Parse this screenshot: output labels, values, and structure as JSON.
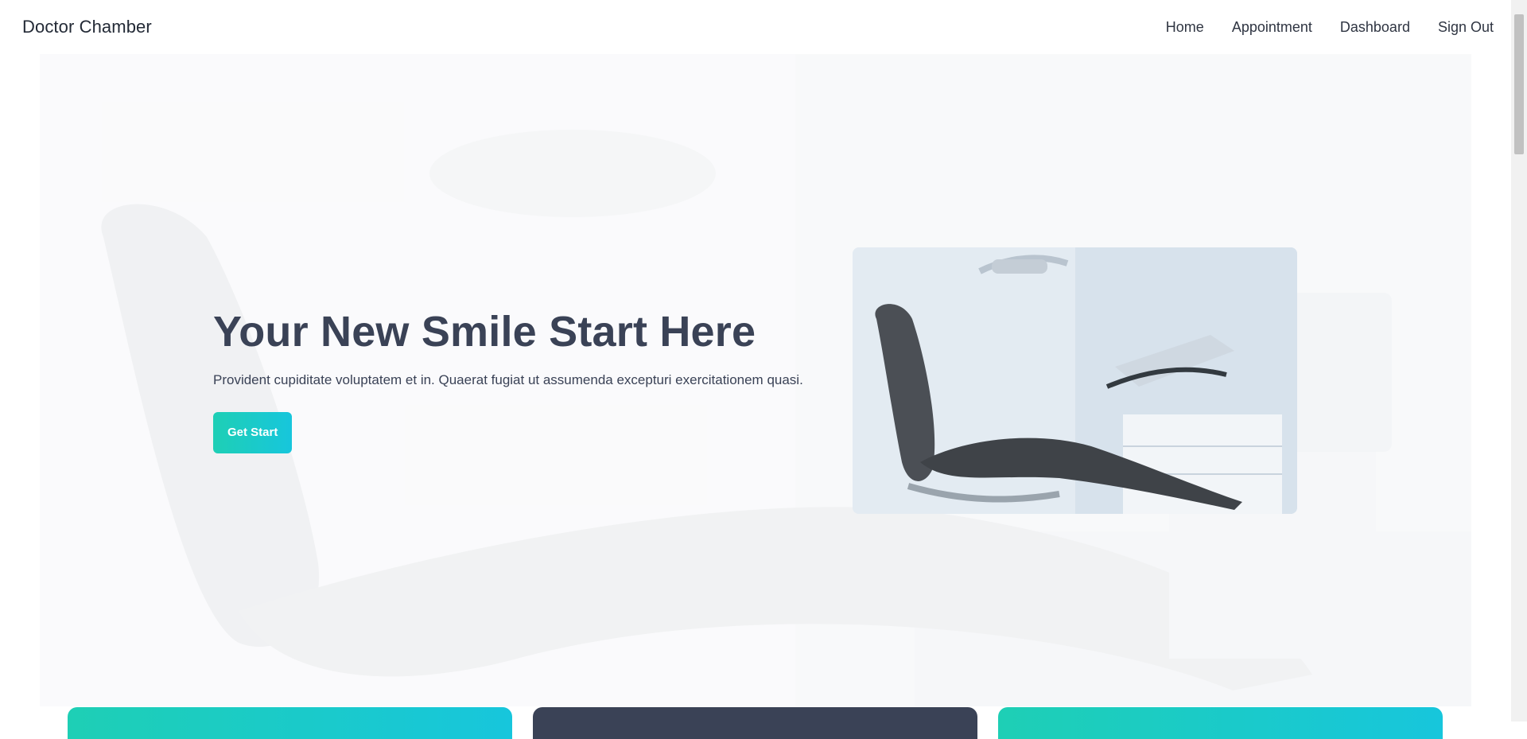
{
  "navbar": {
    "brand": "Doctor Chamber",
    "links": [
      {
        "label": "Home"
      },
      {
        "label": "Appointment"
      },
      {
        "label": "Dashboard"
      },
      {
        "label": "Sign Out"
      }
    ]
  },
  "hero": {
    "title": "Your New Smile Start Here",
    "subtitle": "Provident cupiditate voluptatem et in. Quaerat fugiat ut assumenda excepturi exercitationem quasi.",
    "cta_label": "Get Start",
    "image_icon": "dental-chair-photo",
    "background_icon": "dental-chair-background"
  },
  "cards": [
    {
      "color": "#1ecfb5"
    },
    {
      "color": "#3a4256"
    },
    {
      "color": "#17c6dc"
    }
  ],
  "colors": {
    "accent": "#1ecfb5",
    "accent_end": "#17c6dc",
    "text_dark": "#3a4256"
  }
}
